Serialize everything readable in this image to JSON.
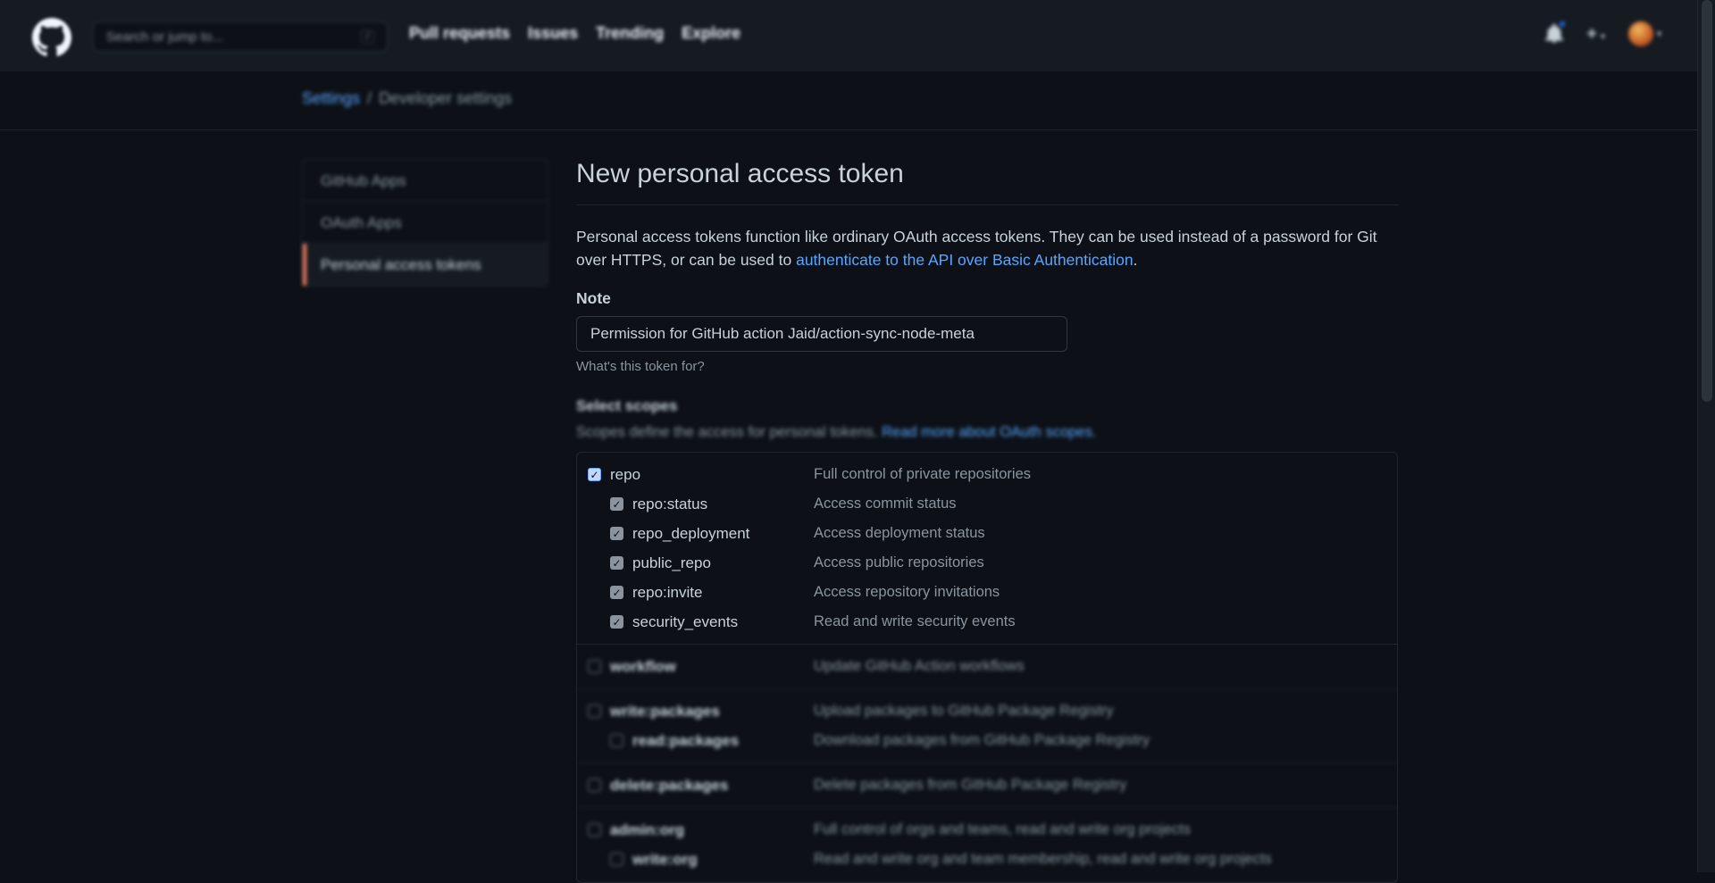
{
  "header": {
    "search_placeholder": "Search or jump to...",
    "search_shortcut": "/",
    "nav": [
      "Pull requests",
      "Issues",
      "Trending",
      "Explore"
    ],
    "plus": "+",
    "caret": "▾"
  },
  "breadcrumb": {
    "root": "Settings",
    "separator": "/",
    "current": "Developer settings"
  },
  "sidebar": {
    "items": [
      {
        "label": "GitHub Apps"
      },
      {
        "label": "OAuth Apps"
      },
      {
        "label": "Personal access tokens"
      }
    ]
  },
  "main": {
    "title": "New personal access token",
    "intro_text": "Personal access tokens function like ordinary OAuth access tokens. They can be used instead of a password for Git over HTTPS, or can be used to ",
    "intro_link": "authenticate to the API over Basic Authentication",
    "intro_end": ".",
    "note_label": "Note",
    "note_value": "Permission for GitHub action Jaid/action-sync-node-meta",
    "note_hint": "What's this token for?",
    "scopes_title": "Select scopes",
    "scopes_desc": "Scopes define the access for personal tokens. ",
    "scopes_link": "Read more about OAuth scopes."
  },
  "scopes": {
    "repo": {
      "name": "repo",
      "desc": "Full control of private repositories",
      "children": [
        {
          "name": "repo:status",
          "desc": "Access commit status"
        },
        {
          "name": "repo_deployment",
          "desc": "Access deployment status"
        },
        {
          "name": "public_repo",
          "desc": "Access public repositories"
        },
        {
          "name": "repo:invite",
          "desc": "Access repository invitations"
        },
        {
          "name": "security_events",
          "desc": "Read and write security events"
        }
      ]
    },
    "workflow": {
      "name": "workflow",
      "desc": "Update GitHub Action workflows"
    },
    "write_packages": {
      "name": "write:packages",
      "desc": "Upload packages to GitHub Package Registry",
      "children": [
        {
          "name": "read:packages",
          "desc": "Download packages from GitHub Package Registry"
        }
      ]
    },
    "delete_packages": {
      "name": "delete:packages",
      "desc": "Delete packages from GitHub Package Registry"
    },
    "admin_org": {
      "name": "admin:org",
      "desc": "Full control of orgs and teams, read and write org projects",
      "children": [
        {
          "name": "write:org",
          "desc": "Read and write org and team membership, read and write org projects"
        }
      ]
    }
  },
  "colors": {
    "bg": "#0d1117",
    "header_bg": "#161b22",
    "accent_link": "#58a6ff",
    "active_marker": "#f78166"
  }
}
